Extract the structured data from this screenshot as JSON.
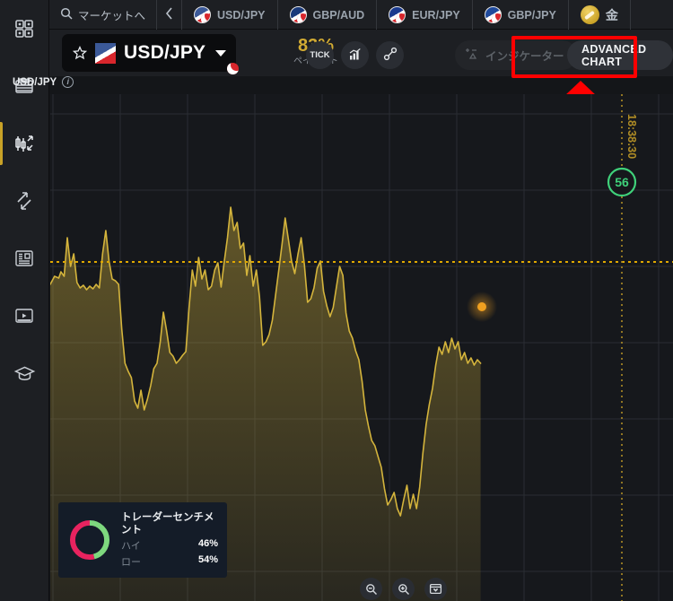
{
  "sidebar": {
    "items": [
      {
        "name": "dashboard",
        "icon": "grid-icon",
        "active": false
      },
      {
        "name": "assets",
        "icon": "list-icon",
        "active": false
      },
      {
        "name": "chart",
        "icon": "candlestick-icon",
        "active": true
      },
      {
        "name": "trade",
        "icon": "arrows-icon",
        "active": false
      },
      {
        "name": "news",
        "icon": "newspaper-icon",
        "active": false
      },
      {
        "name": "video",
        "icon": "video-icon",
        "active": false
      },
      {
        "name": "education",
        "icon": "graduation-cap-icon",
        "active": false
      }
    ]
  },
  "tabbar": {
    "market_label": "マーケットへ",
    "search_icon": "search-icon",
    "back_icon": "chevron-left-icon",
    "tabs": [
      {
        "label": "USD/JPY",
        "flag": "flag-usd"
      },
      {
        "label": "GBP/AUD",
        "flag": "flag-gbp-aud"
      },
      {
        "label": "EUR/JPY",
        "flag": "flag-eur"
      },
      {
        "label": "GBP/JPY",
        "flag": "flag-gbp"
      }
    ],
    "gold_label": "金",
    "gold_icon": "gold-coin-icon"
  },
  "toolbar": {
    "star_icon": "star-icon",
    "symbol": "USD/JPY",
    "caret_icon": "chevron-down-icon",
    "payout_value": "83%",
    "payout_label": "ペイアウト",
    "tick_label": "TICK",
    "chart_type_icon": "bar-chart-icon",
    "draw_icon": "line-tool-icon",
    "indicators_label": "インジケーター",
    "indicators_icon": "indicator-icon",
    "advanced_chart_label": "ADVANCED CHART"
  },
  "subheader": {
    "symbol": "USD/JPY",
    "info_icon": "info-icon",
    "info_glyph": "i"
  },
  "chart_overlay": {
    "countdown": "56",
    "time_label": "18:38:30"
  },
  "sentiment": {
    "title": "トレーダーセンチメント",
    "rows": [
      {
        "label": "ハイ",
        "value": "46%"
      },
      {
        "label": "ロー",
        "value": "54%"
      }
    ],
    "high_color": "#7ed87e",
    "low_color": "#e8235f"
  },
  "zoom_controls": {
    "zoom_out_icon": "zoom-out-icon",
    "zoom_in_icon": "zoom-in-icon",
    "fit_icon": "fit-chart-icon"
  },
  "colors": {
    "line": "#d4b43c",
    "accent": "#c9a227",
    "highlight": "#ff0000",
    "countdown": "#3fd17a",
    "price_dot": "#f0a020"
  },
  "chart_data": {
    "type": "area",
    "title": "USD/JPY",
    "xlabel": "",
    "ylabel": "",
    "grid": true,
    "legend": false,
    "current_time": "18:38:30",
    "price_line_y": 187,
    "series": [
      {
        "name": "USD/JPY",
        "color": "#d4b43c",
        "points": [
          [
            0,
            212
          ],
          [
            4,
            203
          ],
          [
            8,
            205
          ],
          [
            10,
            198
          ],
          [
            13,
            203
          ],
          [
            16,
            160
          ],
          [
            19,
            192
          ],
          [
            22,
            178
          ],
          [
            25,
            210
          ],
          [
            28,
            216
          ],
          [
            31,
            213
          ],
          [
            34,
            218
          ],
          [
            37,
            214
          ],
          [
            40,
            217
          ],
          [
            43,
            212
          ],
          [
            46,
            216
          ],
          [
            49,
            178
          ],
          [
            52,
            152
          ],
          [
            55,
            186
          ],
          [
            58,
            206
          ],
          [
            61,
            208
          ],
          [
            64,
            212
          ],
          [
            67,
            262
          ],
          [
            70,
            300
          ],
          [
            73,
            309
          ],
          [
            76,
            316
          ],
          [
            79,
            342
          ],
          [
            82,
            350
          ],
          [
            85,
            330
          ],
          [
            88,
            352
          ],
          [
            91,
            340
          ],
          [
            94,
            325
          ],
          [
            97,
            306
          ],
          [
            100,
            300
          ],
          [
            103,
            276
          ],
          [
            106,
            243
          ],
          [
            109,
            264
          ],
          [
            112,
            288
          ],
          [
            115,
            292
          ],
          [
            118,
            300
          ],
          [
            121,
            296
          ],
          [
            124,
            291
          ],
          [
            127,
            287
          ],
          [
            130,
            238
          ],
          [
            133,
            196
          ],
          [
            136,
            214
          ],
          [
            139,
            182
          ],
          [
            142,
            206
          ],
          [
            145,
            196
          ],
          [
            148,
            218
          ],
          [
            151,
            214
          ],
          [
            154,
            196
          ],
          [
            157,
            188
          ],
          [
            160,
            215
          ],
          [
            163,
            186
          ],
          [
            166,
            160
          ],
          [
            169,
            126
          ],
          [
            172,
            152
          ],
          [
            175,
            143
          ],
          [
            178,
            172
          ],
          [
            181,
            166
          ],
          [
            184,
            202
          ],
          [
            187,
            180
          ],
          [
            190,
            214
          ],
          [
            193,
            196
          ],
          [
            196,
            226
          ],
          [
            199,
            280
          ],
          [
            202,
            276
          ],
          [
            205,
            268
          ],
          [
            208,
            252
          ],
          [
            211,
            224
          ],
          [
            214,
            196
          ],
          [
            217,
            168
          ],
          [
            220,
            138
          ],
          [
            223,
            162
          ],
          [
            226,
            186
          ],
          [
            229,
            200
          ],
          [
            232,
            178
          ],
          [
            235,
            160
          ],
          [
            238,
            190
          ],
          [
            241,
            232
          ],
          [
            244,
            228
          ],
          [
            247,
            216
          ],
          [
            250,
            194
          ],
          [
            253,
            186
          ],
          [
            256,
            220
          ],
          [
            259,
            236
          ],
          [
            262,
            248
          ],
          [
            265,
            238
          ],
          [
            268,
            215
          ],
          [
            271,
            192
          ],
          [
            274,
            202
          ],
          [
            277,
            244
          ],
          [
            280,
            264
          ],
          [
            283,
            272
          ],
          [
            286,
            286
          ],
          [
            289,
            296
          ],
          [
            292,
            320
          ],
          [
            295,
            352
          ],
          [
            298,
            370
          ],
          [
            301,
            386
          ],
          [
            304,
            392
          ],
          [
            307,
            404
          ],
          [
            310,
            416
          ],
          [
            313,
            440
          ],
          [
            316,
            458
          ],
          [
            319,
            452
          ],
          [
            322,
            444
          ],
          [
            325,
            462
          ],
          [
            328,
            470
          ],
          [
            331,
            452
          ],
          [
            334,
            436
          ],
          [
            337,
            462
          ],
          [
            340,
            446
          ],
          [
            343,
            462
          ],
          [
            346,
            438
          ],
          [
            349,
            400
          ],
          [
            352,
            368
          ],
          [
            355,
            346
          ],
          [
            358,
            328
          ],
          [
            361,
            302
          ],
          [
            364,
            282
          ],
          [
            367,
            290
          ],
          [
            370,
            276
          ],
          [
            373,
            288
          ],
          [
            376,
            272
          ],
          [
            379,
            284
          ],
          [
            382,
            276
          ],
          [
            385,
            296
          ],
          [
            388,
            288
          ],
          [
            391,
            300
          ],
          [
            394,
            294
          ],
          [
            397,
            302
          ],
          [
            400,
            296
          ],
          [
            403,
            300
          ]
        ]
      }
    ]
  }
}
